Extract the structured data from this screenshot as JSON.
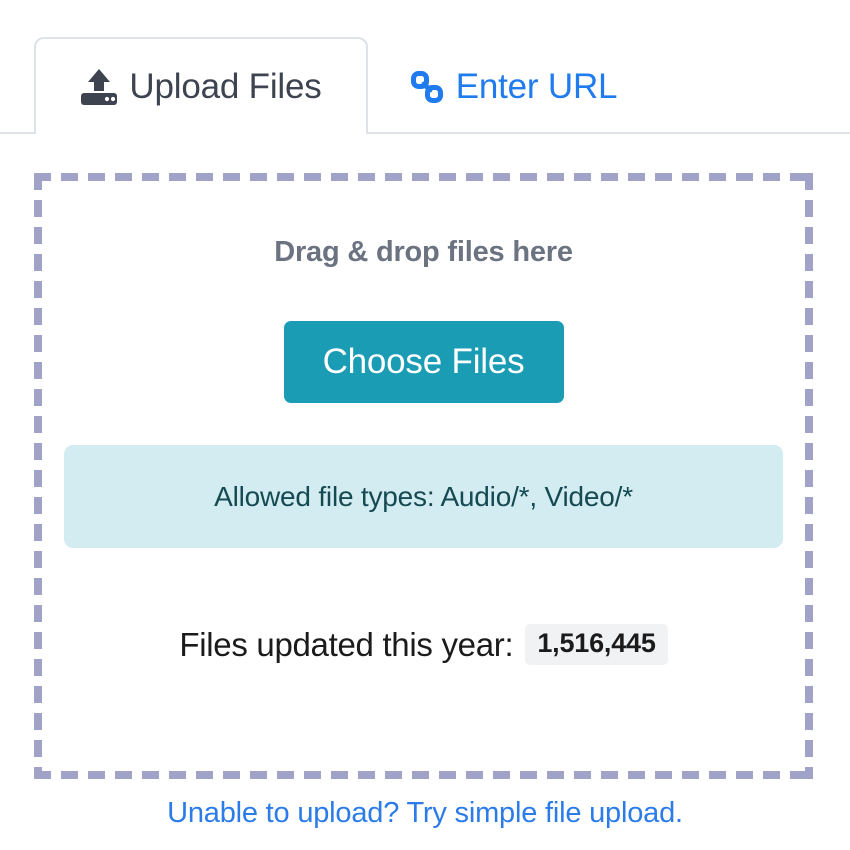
{
  "tabs": [
    {
      "id": "upload-files",
      "label": "Upload Files",
      "icon": "upload-icon",
      "active": true
    },
    {
      "id": "enter-url",
      "label": "Enter URL",
      "icon": "link-icon",
      "active": false
    }
  ],
  "dropzone": {
    "title": "Drag & drop files here",
    "choose_button_label": "Choose Files",
    "allowed_types_text": "Allowed file types: Audio/*, Video/*",
    "counter_label": "Files updated this year:",
    "counter_value": "1,516,445"
  },
  "footer": {
    "link_text": "Unable to upload? Try simple file upload."
  },
  "colors": {
    "accent_teal": "#1a9cb4",
    "link_blue": "#2b7ce9",
    "tab_blue": "#1f7bee",
    "dash_border": "#a0a2c8",
    "banner_bg": "#d3ecf1",
    "banner_text": "#154a52",
    "tab_border": "#dee2e6",
    "title_gray": "#6b7280",
    "pill_bg": "#f1f2f4"
  }
}
